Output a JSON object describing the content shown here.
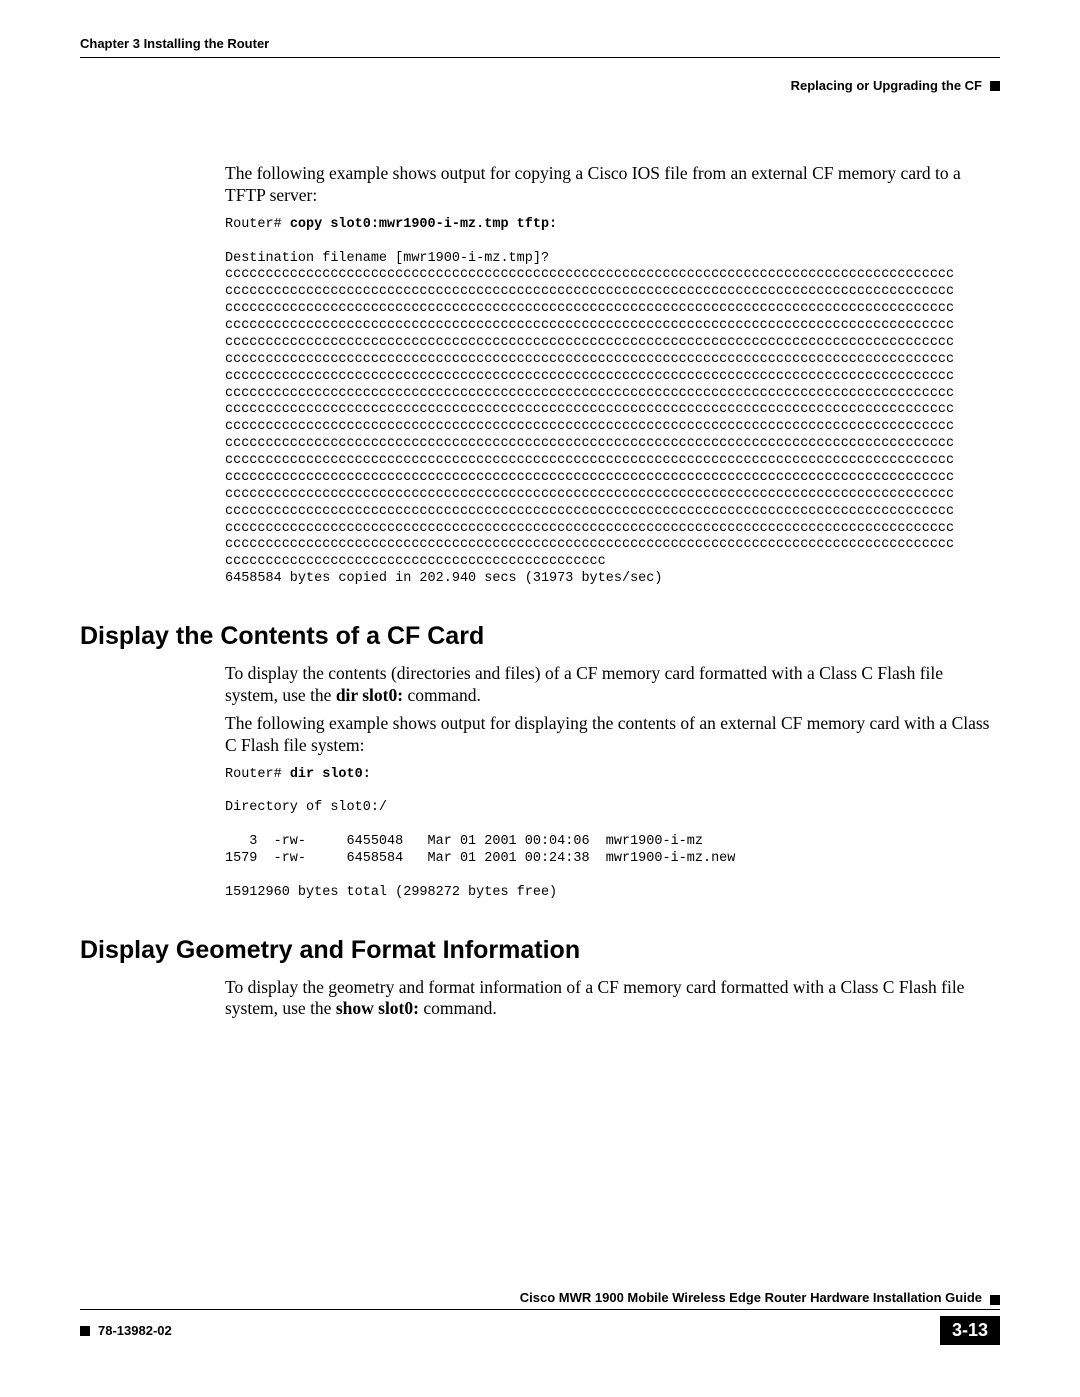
{
  "header": {
    "chapter": "Chapter 3    Installing the Router",
    "section": "Replacing or Upgrading the CF"
  },
  "intro1": "The following example shows output for copying a Cisco IOS file from an external CF memory card to a TFTP server:",
  "cmd1_prompt": "Router# ",
  "cmd1_bold": "copy slot0:mwr1900-i-mz.tmp tftp:",
  "output1_line1": "Destination filename [mwr1900-i-mz.tmp]?",
  "output1_cline": "cccccccccccccccccccccccccccccccccccccccccccccccccccccccccccccccccccccccccccccccccccccccccc",
  "output1_clast": "ccccccccccccccccccccccccccccccccccccccccccccccc",
  "output1_end": "6458584 bytes copied in 202.940 secs (31973 bytes/sec)",
  "h2a": "Display the Contents of a CF Card",
  "para2a": "To display the contents (directories and files) of a CF memory card formatted with a Class C Flash file system, use the ",
  "para2a_bold": "dir slot0:",
  "para2a_after": " command.",
  "para2b": "The following example shows output for displaying the contents of an external CF memory card with a Class C Flash file system:",
  "cmd2_prompt": "Router# ",
  "cmd2_bold": "dir slot0:",
  "output2": "Directory of slot0:/\n\n   3  -rw-     6455048   Mar 01 2001 00:04:06  mwr1900-i-mz\n1579  -rw-     6458584   Mar 01 2001 00:24:38  mwr1900-i-mz.new\n\n15912960 bytes total (2998272 bytes free)",
  "h2b": "Display Geometry and Format Information",
  "para3a": "To display the geometry and format information of a CF memory card formatted with a Class C Flash file system, use the ",
  "para3a_bold": "show slot0:",
  "para3a_after": " command.",
  "footer": {
    "title": "Cisco MWR 1900 Mobile Wireless Edge Router Hardware Installation Guide",
    "doc": "78-13982-02",
    "page": "3-13"
  }
}
